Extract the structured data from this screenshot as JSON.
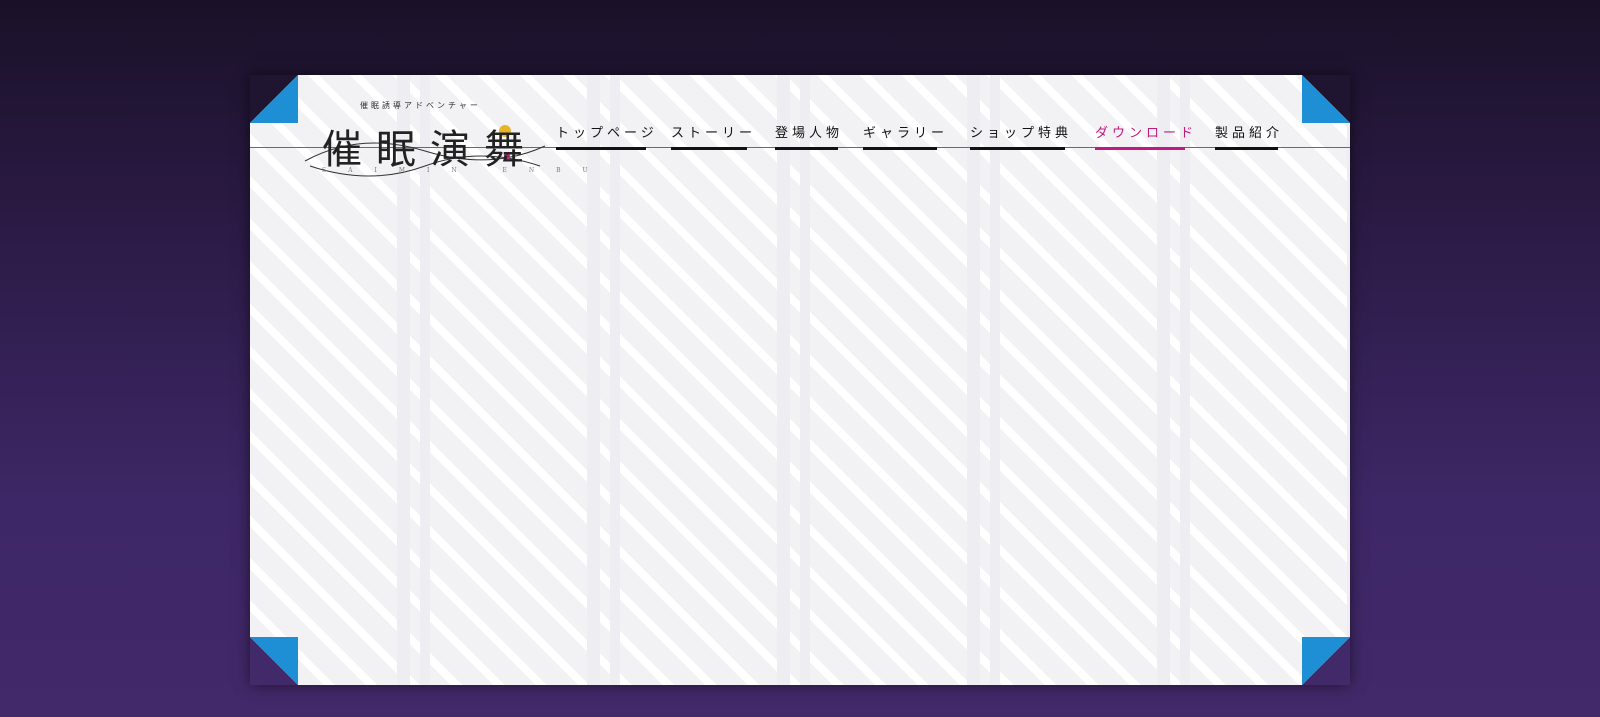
{
  "logo": {
    "subtitle": "催眠誘導アドベンチャー",
    "title": "催眠演舞",
    "romaji": "SAIMIN ENBU"
  },
  "nav": {
    "items": [
      {
        "label": "トップページ",
        "active": false
      },
      {
        "label": "ストーリー",
        "active": false
      },
      {
        "label": "登場人物",
        "active": false
      },
      {
        "label": "ギャラリー",
        "active": false
      },
      {
        "label": "ショップ特典",
        "active": false
      },
      {
        "label": "ダウンロード",
        "active": true
      },
      {
        "label": "製品紹介",
        "active": false
      }
    ]
  },
  "colors": {
    "accent": "#c01a7c",
    "corner": "#1e8fd4",
    "nav_text": "#111111"
  }
}
